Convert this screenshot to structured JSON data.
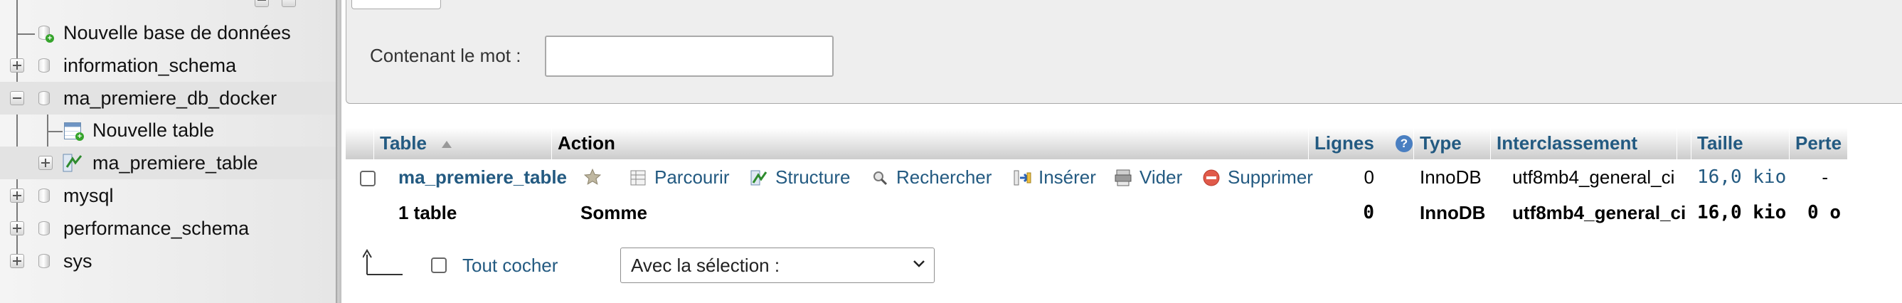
{
  "nav": {
    "items": [
      {
        "label": "Nouvelle base de données"
      },
      {
        "label": "information_schema"
      },
      {
        "label": "ma_premiere_db_docker"
      },
      {
        "label": "Nouvelle table"
      },
      {
        "label": "ma_premiere_table"
      },
      {
        "label": "mysql"
      },
      {
        "label": "performance_schema"
      },
      {
        "label": "sys"
      }
    ]
  },
  "filter": {
    "label": "Contenant le mot :",
    "value": ""
  },
  "table": {
    "headers": {
      "table": "Table",
      "action": "Action",
      "rows": "Lignes",
      "type": "Type",
      "collation": "Interclassement",
      "size": "Taille",
      "overhead": "Perte"
    },
    "row": {
      "name": "ma_premiere_table",
      "actions": {
        "browse": "Parcourir",
        "structure": "Structure",
        "search": "Rechercher",
        "insert": "Insérer",
        "empty": "Vider",
        "drop": "Supprimer"
      },
      "rows": "0",
      "type": "InnoDB",
      "collation": "utf8mb4_general_ci",
      "size": "16,0 kio",
      "overhead": "-"
    },
    "footer": {
      "count": "1 table",
      "sum_label": "Somme",
      "rows": "0",
      "type": "InnoDB",
      "collation": "utf8mb4_general_ci",
      "size": "16,0 kio",
      "overhead": "0 o"
    }
  },
  "bulk": {
    "check_all": "Tout cocher",
    "with_selected": "Avec la sélection :"
  },
  "colors": {
    "link": "#235a81",
    "drop_icon": "#e05a4a",
    "add_badge": "#36a42c"
  }
}
